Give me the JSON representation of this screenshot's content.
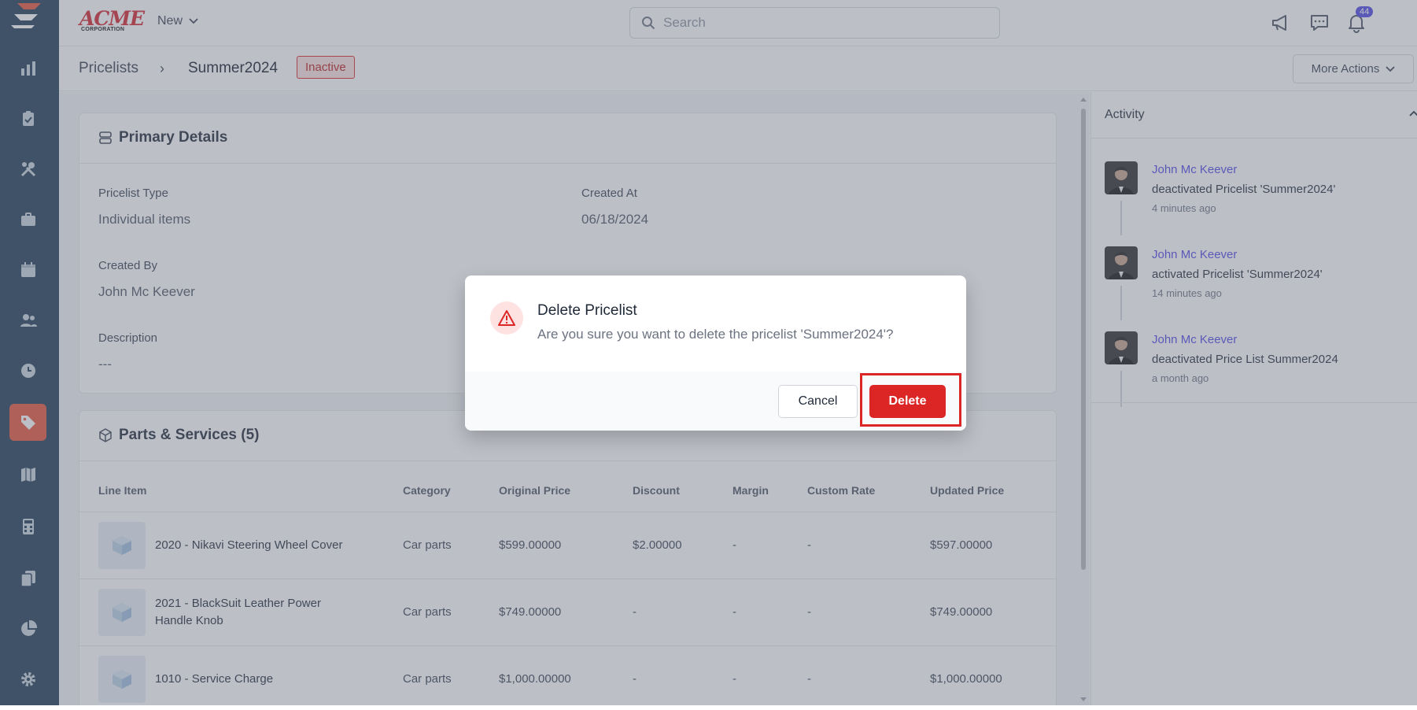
{
  "header": {
    "brand_main": "ACME",
    "brand_sub": "CORPORATION",
    "new_label": "New",
    "search_placeholder": "Search",
    "notifications_count": "44"
  },
  "breadcrumb": {
    "parent": "Pricelists",
    "separator": "›",
    "current": "Summer2024",
    "status": "Inactive"
  },
  "more_actions_label": "More Actions",
  "primary_details": {
    "title": "Primary Details",
    "fields": [
      {
        "label": "Pricelist Type",
        "value": "Individual items"
      },
      {
        "label": "Created At",
        "value": "06/18/2024"
      },
      {
        "label": "Created By",
        "value": "John Mc Keever"
      },
      {
        "label": "Description",
        "value": "---"
      }
    ]
  },
  "parts": {
    "title": "Parts & Services (5)",
    "columns": [
      "Line Item",
      "Category",
      "Original Price",
      "Discount",
      "Margin",
      "Custom Rate",
      "Updated Price"
    ],
    "rows": [
      {
        "name": "2020 - Nikavi Steering Wheel Cover",
        "category": "Car parts",
        "original": "$599.00000",
        "discount": "$2.00000",
        "margin": "-",
        "custom": "-",
        "updated": "$597.00000"
      },
      {
        "name": "2021 - BlackSuit Leather Power Handle Knob",
        "category": "Car parts",
        "original": "$749.00000",
        "discount": "-",
        "margin": "-",
        "custom": "-",
        "updated": "$749.00000"
      },
      {
        "name": "1010 - Service Charge",
        "category": "Car parts",
        "original": "$1,000.00000",
        "discount": "-",
        "margin": "-",
        "custom": "-",
        "updated": "$1,000.00000"
      }
    ]
  },
  "activity": {
    "title": "Activity",
    "items": [
      {
        "user": "John Mc Keever",
        "text": "deactivated Pricelist 'Summer2024'",
        "time": "4 minutes ago"
      },
      {
        "user": "John Mc Keever",
        "text": "activated Pricelist 'Summer2024'",
        "time": "14 minutes ago"
      },
      {
        "user": "John Mc Keever",
        "text": "deactivated Price List Summer2024",
        "time": "a month ago"
      }
    ]
  },
  "modal": {
    "title": "Delete Pricelist",
    "message": "Are you sure you want to delete the pricelist 'Summer2024'?",
    "cancel_label": "Cancel",
    "delete_label": "Delete"
  },
  "colors": {
    "sidebar": "#1e3a52",
    "sidebar_active": "#e8553a",
    "danger": "#dc2626",
    "link": "#4f46e5"
  },
  "sidebar_icons": [
    "dashboard-icon",
    "clipboard-icon",
    "tools-icon",
    "briefcase-icon",
    "calendar-icon",
    "users-icon",
    "clock-icon",
    "tag-icon",
    "map-icon",
    "calculator-icon",
    "documents-icon",
    "pie-chart-icon",
    "gear-icon"
  ]
}
